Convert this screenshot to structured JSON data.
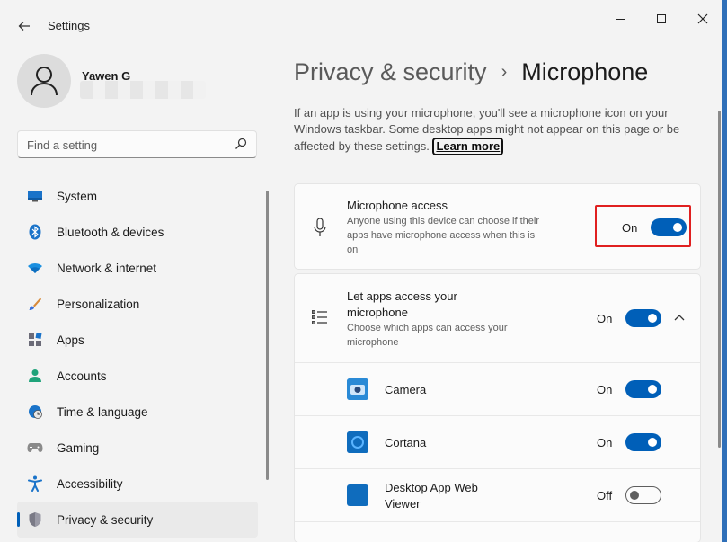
{
  "window": {
    "app_title": "Settings"
  },
  "user": {
    "name": "Yawen G"
  },
  "search": {
    "placeholder": "Find a setting"
  },
  "sidebar": {
    "items": [
      {
        "label": "System",
        "icon": "monitor-icon",
        "active": false
      },
      {
        "label": "Bluetooth & devices",
        "icon": "bluetooth-icon",
        "active": false
      },
      {
        "label": "Network & internet",
        "icon": "wifi-icon",
        "active": false
      },
      {
        "label": "Personalization",
        "icon": "brush-icon",
        "active": false
      },
      {
        "label": "Apps",
        "icon": "apps-icon",
        "active": false
      },
      {
        "label": "Accounts",
        "icon": "person-icon",
        "active": false
      },
      {
        "label": "Time & language",
        "icon": "clock-globe-icon",
        "active": false
      },
      {
        "label": "Gaming",
        "icon": "gamepad-icon",
        "active": false
      },
      {
        "label": "Accessibility",
        "icon": "accessibility-icon",
        "active": false
      },
      {
        "label": "Privacy & security",
        "icon": "shield-icon",
        "active": true
      }
    ]
  },
  "breadcrumb": {
    "parent": "Privacy & security",
    "separator": "›",
    "current": "Microphone"
  },
  "description": {
    "text": "If an app is using your microphone, you'll see a microphone icon on your Windows taskbar. Some desktop apps might not appear on this page or be affected by these settings.",
    "learn_more": "Learn more"
  },
  "microphone_access": {
    "title": "Microphone access",
    "subtitle": "Anyone using this device can choose if their apps have microphone access when this is on",
    "state": "On",
    "on": true
  },
  "let_apps": {
    "title": "Let apps access your microphone",
    "subtitle": "Choose which apps can access your microphone",
    "state": "On",
    "on": true,
    "expanded": true
  },
  "apps": [
    {
      "name": "Camera",
      "icon": "camera-app-icon",
      "state": "On",
      "on": true
    },
    {
      "name": "Cortana",
      "icon": "cortana-app-icon",
      "state": "On",
      "on": true
    },
    {
      "name": "Desktop App Web Viewer",
      "icon": "web-viewer-app-icon",
      "state": "Off",
      "on": false
    }
  ],
  "colors": {
    "accent": "#005fb8",
    "highlight": "#e02020",
    "background": "#f3f3f3",
    "card": "#fbfbfb"
  }
}
